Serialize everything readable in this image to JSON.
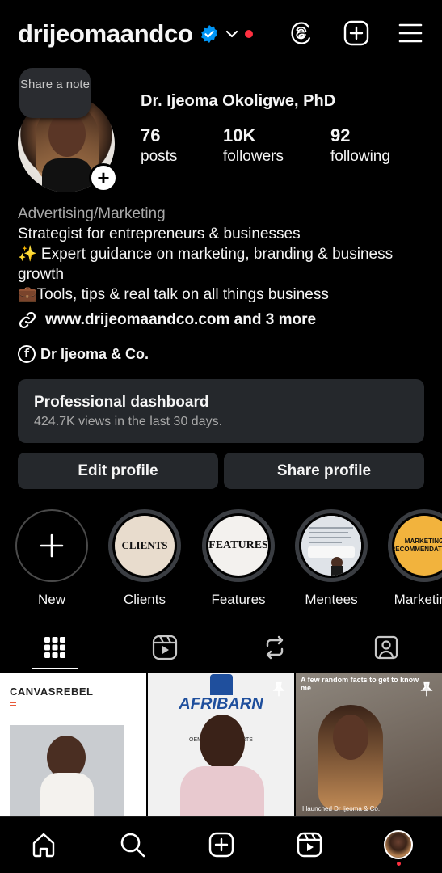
{
  "header": {
    "username": "drijeomaandco"
  },
  "profile": {
    "note": "Share a note",
    "full_name": "Dr. Ijeoma Okoligwe, PhD",
    "stats": [
      {
        "value": "76",
        "label": "posts"
      },
      {
        "value": "10K",
        "label": "followers"
      },
      {
        "value": "92",
        "label": "following"
      }
    ]
  },
  "bio": {
    "category": "Advertising/Marketing",
    "line1": "Strategist for entrepreneurs & businesses",
    "line2": "✨ Expert guidance on marketing, branding & business growth",
    "line3": "💼Tools, tips & real talk on all things business",
    "link": "www.drijeomaandco.com and 3 more",
    "facebook": "Dr Ijeoma & Co."
  },
  "dashboard": {
    "title": "Professional dashboard",
    "subtitle": "424.7K views in the last 30 days."
  },
  "buttons": {
    "edit": "Edit profile",
    "share": "Share profile"
  },
  "highlights": [
    {
      "label": "New",
      "cover": ""
    },
    {
      "label": "Clients",
      "cover": "CLIENTS"
    },
    {
      "label": "Features",
      "cover": "FEATURES"
    },
    {
      "label": "Mentees",
      "cover": ""
    },
    {
      "label": "Marketing",
      "cover": "MARKETING RECOMMENDATIONS"
    }
  ],
  "posts": [
    {
      "overlay": "CANVASREBEL"
    },
    {
      "overlay": "AFRIBARN",
      "caption": "OEM & QUALITY PARTS"
    },
    {
      "overlay": "A few random facts to get to know me",
      "caption": "I launched Dr Ijeoma & Co."
    }
  ],
  "colors": {
    "background": "#000000",
    "surface": "#25282c",
    "verified": "#0095f6",
    "notification": "#ff3040",
    "muted_text": "#a8a8a8"
  }
}
